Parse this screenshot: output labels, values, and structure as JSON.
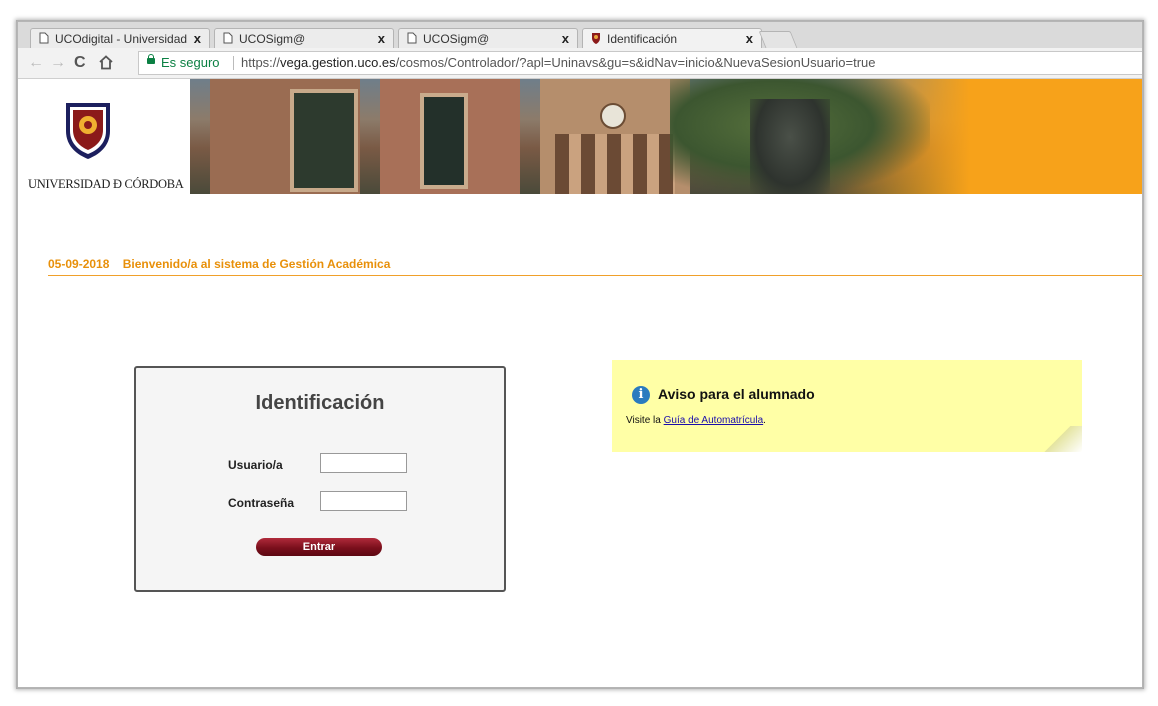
{
  "browser": {
    "tabs": [
      {
        "title": "UCOdigital - Universidad",
        "close": "x"
      },
      {
        "title": "UCOSigm@",
        "close": "x"
      },
      {
        "title": "UCOSigm@",
        "close": "x"
      },
      {
        "title": "Identificación",
        "close": "x"
      }
    ],
    "secure_label": "Es seguro",
    "url_prefix": "https://",
    "url_host": "vega.gestion.uco.es",
    "url_rest": "/cosmos/Controlador/?apl=Uninavs&gu=s&idNav=inicio&NuevaSesionUsuario=true"
  },
  "header": {
    "logo_text": "UNIVERSIDAD Ð CÓRDOBA"
  },
  "welcome": {
    "date": "05-09-2018",
    "message": "Bienvenido/a al sistema de Gestión Académica"
  },
  "login": {
    "title": "Identificación",
    "user_label": "Usuario/a",
    "password_label": "Contraseña",
    "submit_label": "Entrar"
  },
  "notice": {
    "title": "Aviso para el alumnado",
    "text_before": "Visite la ",
    "link_text": "Guía de Automatrícula",
    "text_after": "."
  },
  "colors": {
    "accent_orange": "#f7a21a",
    "welcome_text": "#e8900a",
    "button": "#7a0f1c",
    "notice_bg": "#ffffa6",
    "secure_green": "#0b8043"
  }
}
